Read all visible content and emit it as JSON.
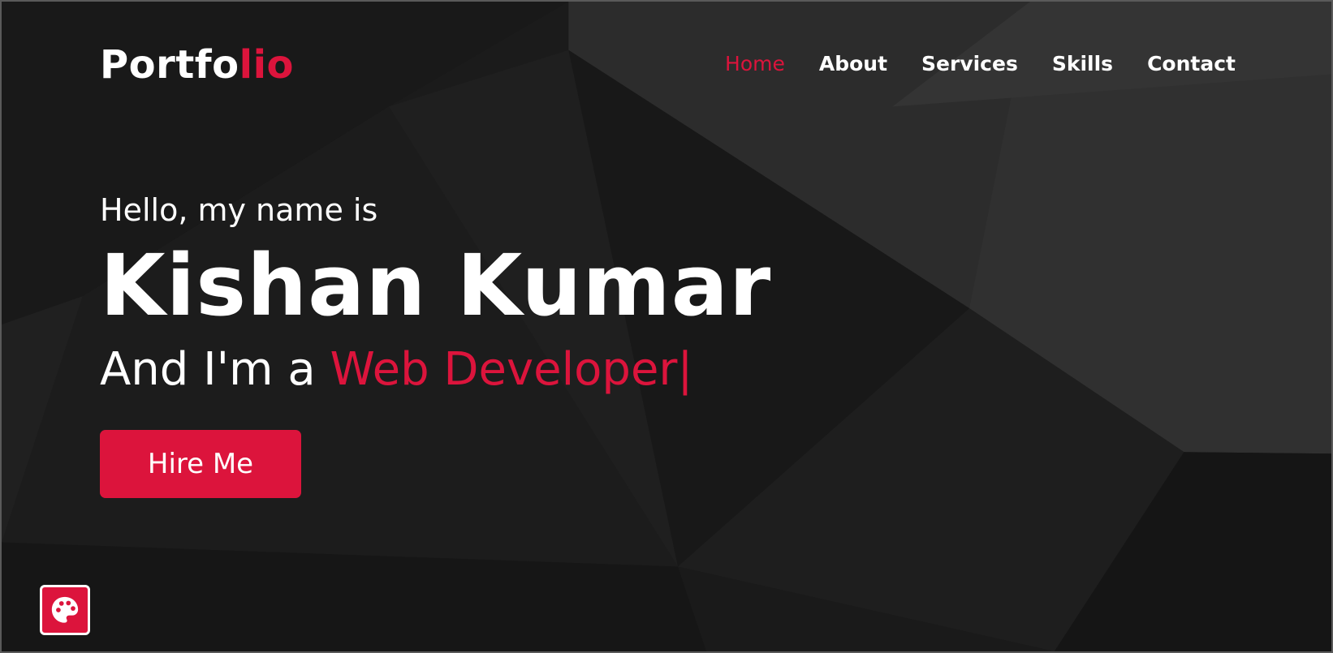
{
  "logo": {
    "main": "Portfo",
    "accent": "lio"
  },
  "nav": {
    "items": [
      {
        "label": "Home",
        "active": true
      },
      {
        "label": "About",
        "active": false
      },
      {
        "label": "Services",
        "active": false
      },
      {
        "label": "Skills",
        "active": false
      },
      {
        "label": "Contact",
        "active": false
      }
    ]
  },
  "hero": {
    "greeting": "Hello, my name is",
    "name": "Kishan Kumar",
    "role_prefix": "And I'm a ",
    "role_typed": "Web Developer",
    "cursor": "|",
    "button_label": "Hire Me"
  },
  "theme": {
    "accent": "#dc143c",
    "text": "#ffffff",
    "background": "#1b1b1b"
  },
  "icons": {
    "theme_toggle": "palette-icon"
  }
}
